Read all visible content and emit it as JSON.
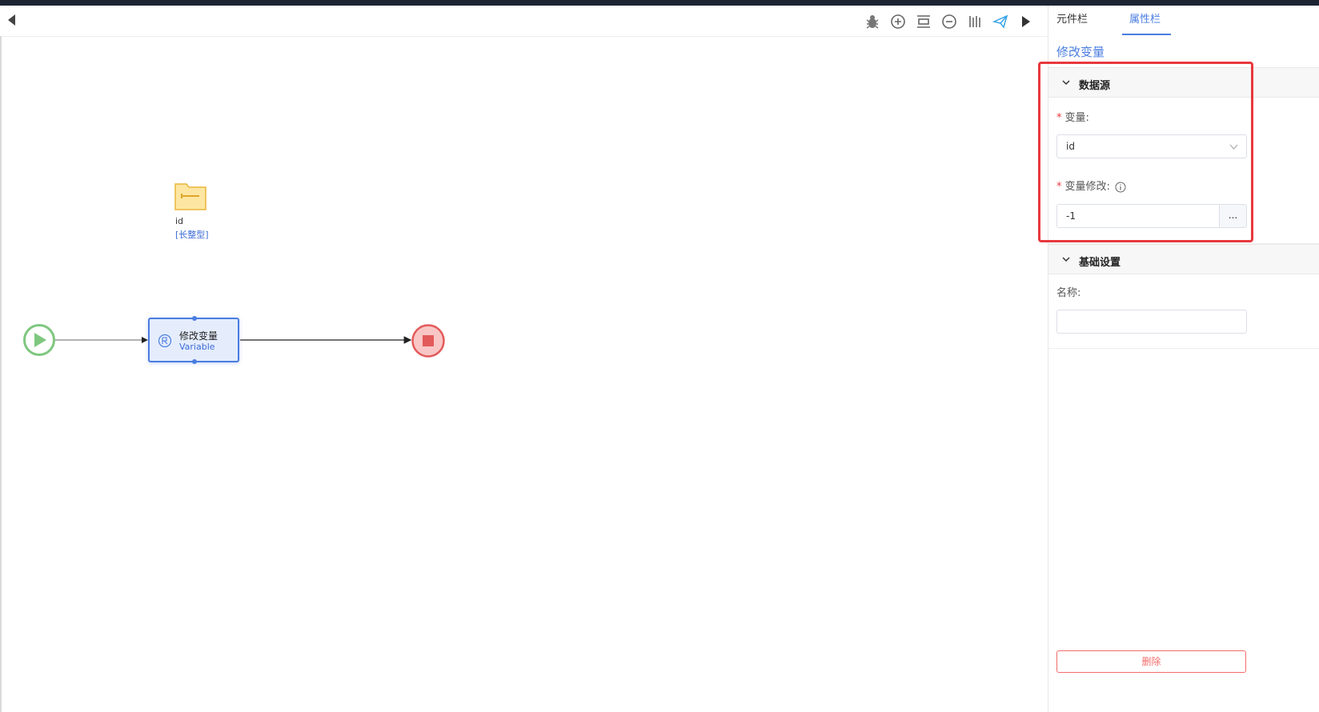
{
  "canvas": {
    "toolbar": {
      "debug_icon": "bug-icon",
      "zoom_in_icon": "zoom-in-icon",
      "fit_icon": "fit-screen-icon",
      "zoom_out_icon": "zoom-out-icon",
      "align_icon": "align-icon",
      "publish_icon": "send-icon",
      "expand_icon": "play-right-icon"
    },
    "variable": {
      "name": "id",
      "type": "[长整型]"
    },
    "task_node": {
      "title": "修改变量",
      "subtitle": "Variable"
    }
  },
  "panel": {
    "tabs": [
      {
        "label": "元件栏"
      },
      {
        "label": "属性栏"
      }
    ],
    "title": "修改变量",
    "data_source": {
      "header": "数据源",
      "variable_label": "变量:",
      "variable_value": "id",
      "modify_label": "变量修改:",
      "modify_value": "-1",
      "more_label": "..."
    },
    "basic": {
      "header": "基础设置",
      "name_label": "名称:",
      "name_value": ""
    },
    "delete_label": "删除"
  },
  "colors": {
    "accent": "#4a7de0",
    "start": "#6cbf6c",
    "end": "#e35a5a",
    "highlight": "#e8383d",
    "folder": "#f5c243"
  }
}
